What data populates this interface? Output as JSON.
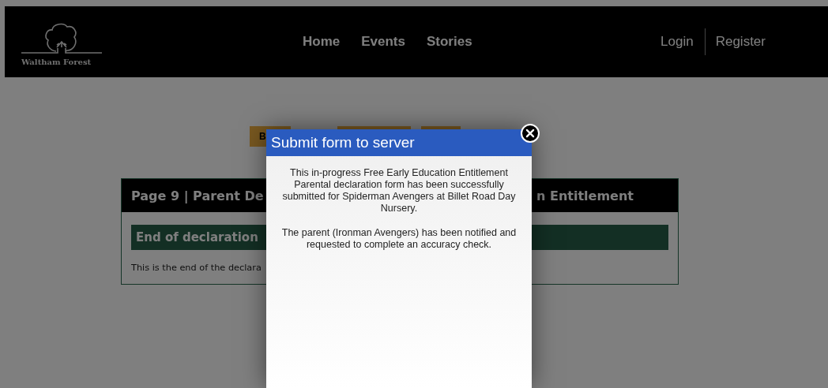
{
  "header": {
    "logo_text": "Waltham Forest",
    "nav": [
      {
        "label": "Home"
      },
      {
        "label": "Events"
      },
      {
        "label": "Stories"
      }
    ],
    "account": [
      {
        "label": "Login"
      },
      {
        "label": "Register"
      }
    ]
  },
  "action_buttons": [
    {
      "kind": "labeled",
      "label": "B"
    },
    {
      "kind": "blank"
    },
    {
      "kind": "blank"
    }
  ],
  "card": {
    "title_start": "Page 9 | Parent De",
    "title_end": "n Entitlement",
    "section_title": "End of declaration",
    "text": "This is the end of the declara"
  },
  "modal": {
    "title": "Submit form to server",
    "paragraphs": [
      "This in-progress Free Early Education Entitlement Parental declaration form has been successfully submitted for Spiderman Avengers at Billet Road Day Nursery.",
      "The parent (Ironman Avengers) has been notified and requested to complete an accuracy check."
    ]
  }
}
